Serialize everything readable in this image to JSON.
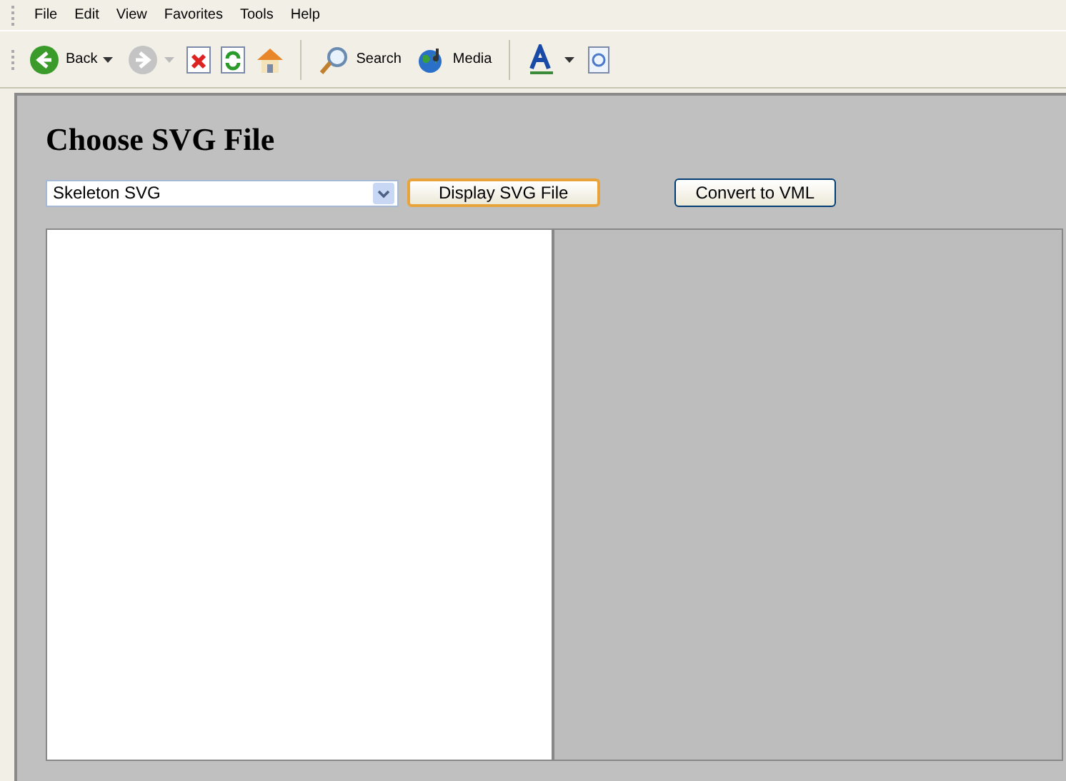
{
  "menu": [
    "File",
    "Edit",
    "View",
    "Favorites",
    "Tools",
    "Help"
  ],
  "toolbar": {
    "back": "Back",
    "search": "Search",
    "media": "Media",
    "forward_disabled": true
  },
  "title": "Choose SVG File",
  "select": {
    "value": "Skeleton SVG"
  },
  "buttons": [
    {
      "label": "Display SVG File",
      "focused": true
    },
    {
      "label": "Convert to VML",
      "focused": false
    }
  ]
}
